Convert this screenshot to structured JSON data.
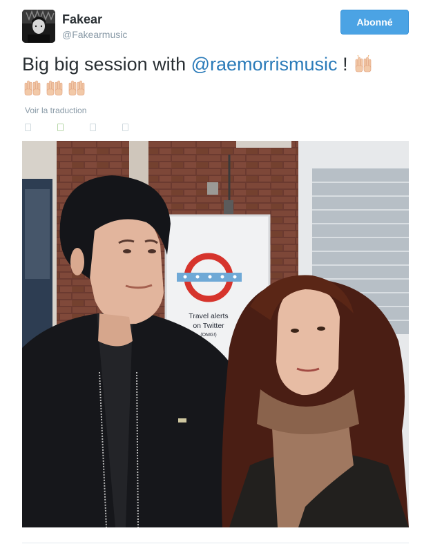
{
  "user": {
    "name": "Fakear",
    "handle": "@Fakearmusic",
    "avatar_icon": "profile-photo"
  },
  "follow_button": {
    "label": "Abonné",
    "color": "#4ba3e4"
  },
  "tweet": {
    "text_before": "Big big session with ",
    "mention": "@raemorrismusic",
    "text_after": " ! ",
    "emoji": "raising-hands-icon",
    "emoji_count": 4
  },
  "translate_link": "Voir la traduction",
  "actions": [
    "reply-icon",
    "retweet-icon",
    "like-icon",
    "more-icon"
  ],
  "photo": {
    "sign_line1": "Travel alerts",
    "sign_line2": "on Twitter",
    "sign_line3": "(OMG!)"
  },
  "colors": {
    "mention": "#2b7bb9",
    "meta": "#8899a6",
    "text": "#292f33"
  }
}
